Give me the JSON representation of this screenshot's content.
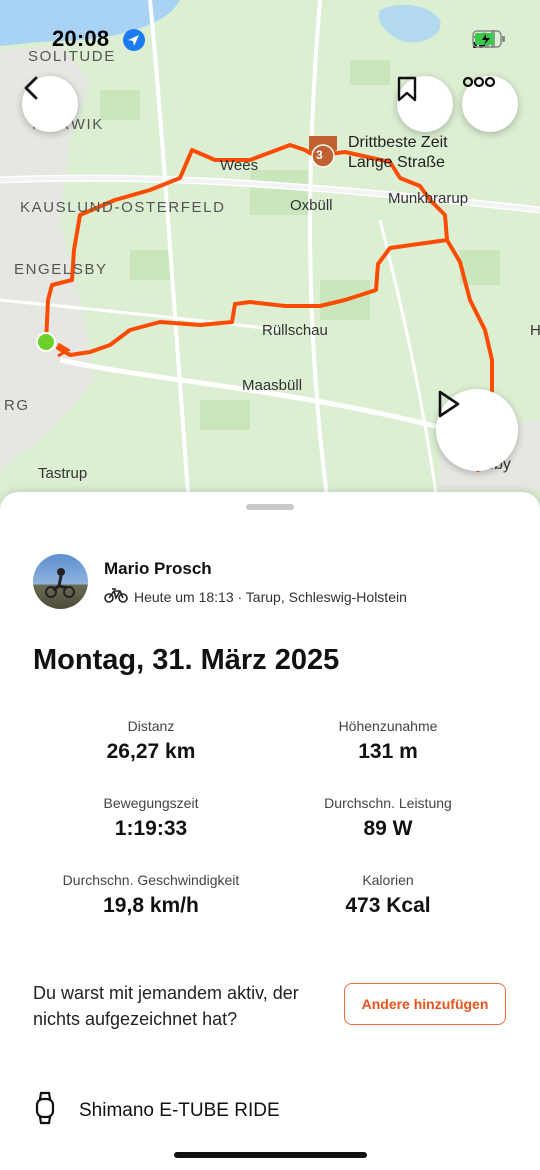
{
  "status_bar": {
    "time": "20:08"
  },
  "map": {
    "labels": {
      "solitude": "SOLITUDE",
      "murwik": "MÜRWIK",
      "kauslund": "KAUSLUND-OSTERFELD",
      "engelsby": "ENGELSBY",
      "rg": "RG",
      "wees": "Wees",
      "oxbull": "Oxbüll",
      "munkbrarup": "Munkbrarup",
      "rullschau": "Rüllschau",
      "maasbull": "Maasbüll",
      "tastrup": "Tastrup",
      "sby": "sby",
      "h": "H"
    },
    "segment": {
      "line1": "Drittbeste Zeit",
      "line2": "Lange Straße",
      "rank": "3"
    },
    "colors": {
      "route": "#fc4c02",
      "start": "#6bd12a",
      "water": "#a9d3f5"
    }
  },
  "activity": {
    "athlete": "Mario Prosch",
    "meta": "Heute um 18:13 · Tarup, Schleswig-Holstein",
    "title": "Montag, 31. März 2025",
    "stats": [
      {
        "label": "Distanz",
        "value": "26,27 km"
      },
      {
        "label": "Höhenzunahme",
        "value": "131 m"
      },
      {
        "label": "Bewegungszeit",
        "value": "1:19:33"
      },
      {
        "label": "Durchschn. Leistung",
        "value": "89 W"
      },
      {
        "label": "Durchschn. Geschwindigkeit",
        "value": "19,8 km/h"
      },
      {
        "label": "Kalorien",
        "value": "473 Kcal"
      }
    ],
    "prompt": "Du warst mit jemandem aktiv, der nichts aufgezeichnet hat?",
    "add_button": "Andere hinzufügen",
    "device": "Shimano E-TUBE RIDE"
  }
}
